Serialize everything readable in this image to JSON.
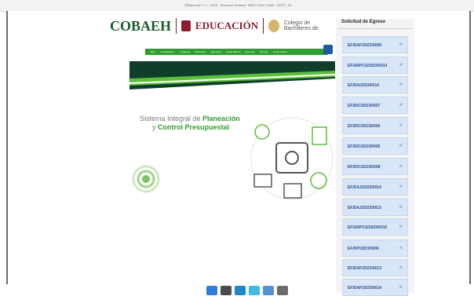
{
  "header": {
    "app_header_text": "SIPlanConP V. 1 · 2023 · Dirección General · MELO DIAZ JUAN · DCP1 · 03",
    "brand_cobaeh": "COBAEH",
    "brand_educacion": "EDUCACIÓN",
    "brand_colegio": "Colegio de Bachilleres de"
  },
  "nav": {
    "items": [
      "Inicio",
      "Configuración",
      "Catálogos",
      "Planeación",
      "Ejecución",
      "Carga Masiva",
      "Reportes",
      "Cifrados",
      "Cerrar Sesión"
    ]
  },
  "main": {
    "title_line1_prefix": "Sistema Integral de ",
    "title_line1_bold": "Planeación",
    "title_line2_prefix": "y ",
    "title_line2_bold": "Control Presupuestal"
  },
  "panel": {
    "title": "Solicitud de Egreso",
    "items": [
      {
        "label": "EF/DAF/2023/0009",
        "close": "×"
      },
      {
        "label": "EF/ARPCS/2023/0014",
        "close": "×"
      },
      {
        "label": "EF/DA/2023/0014",
        "close": "×"
      },
      {
        "label": "EF/DIC/2023/0007",
        "close": "×"
      },
      {
        "label": "EF/DIC/2023/0006",
        "close": "×"
      },
      {
        "label": "EF/DIC/2023/0005",
        "close": "×"
      },
      {
        "label": "EF/DIC/2023/0008",
        "close": "×"
      },
      {
        "label": "EF/DAJ/2023/0014",
        "close": "×"
      },
      {
        "label": "EF/DAJ/2023/0013",
        "close": "×"
      },
      {
        "label": "EF/ARPCS/2023/0016",
        "close": "×"
      },
      {
        "label": "EF/DP/2023/0006",
        "close": "×"
      },
      {
        "label": "EF/DAF/2023/0013",
        "close": "×"
      },
      {
        "label": "EF/DAF/2023/0014",
        "close": "×"
      }
    ]
  },
  "colors": {
    "accent_green": "#2e9f2e",
    "brand_wine": "#8d1b2e",
    "item_bg": "#d9e6f7",
    "item_text": "#2a4e8a"
  },
  "icons": {
    "window_nav_icon": "navigation-icon",
    "taskbar": [
      "windows-icon",
      "terminal-icon",
      "explorer-icon",
      "browser-icon",
      "chrome-icon",
      "folder-icon"
    ]
  }
}
